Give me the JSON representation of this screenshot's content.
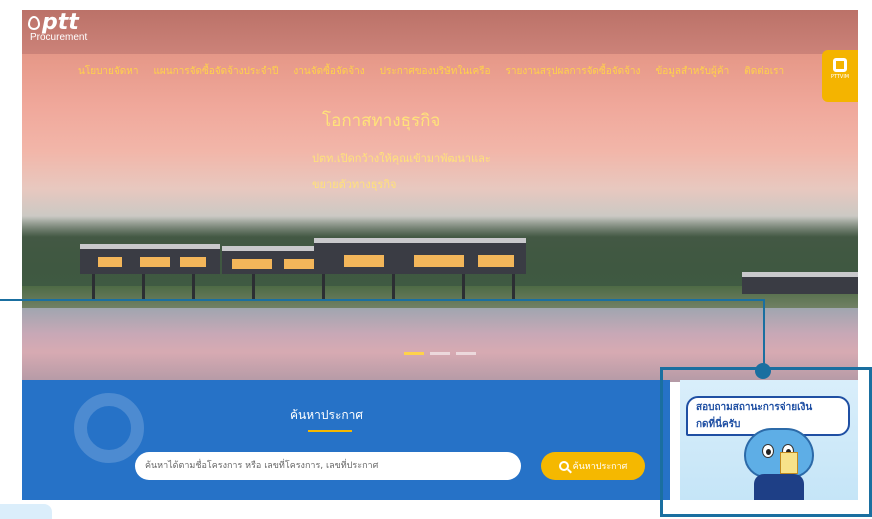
{
  "brand": {
    "logo_text": "ptt",
    "sub_text": "Procurement"
  },
  "nav": {
    "items": [
      "นโยบายจัดหา",
      "แผนการจัดซื้อจัดจ้างประจำปี",
      "งานจัดซื้อจัดจ้าง",
      "ประกาศของบริษัทในเครือ",
      "รายงานสรุปผลการจัดซื้อจัดจ้าง",
      "ข้อมูลสำหรับผู้ค้า",
      "ติดต่อเรา"
    ],
    "pttvim_label": "PTTVIM"
  },
  "hero": {
    "title": "โอกาสทางธุรกิจ",
    "subtitle_line1": "ปตท.เปิดกว้างให้คุณเข้ามาพัฒนาและ",
    "subtitle_line2": "ขยายตัวทางธุรกิจ",
    "active_slide": 1,
    "slide_count": 3
  },
  "search": {
    "title": "ค้นหาประกาศ",
    "placeholder": "ค้นหาได้ตามชื่อโครงการ หรือ เลขที่โครงการ, เลขที่ประกาศ",
    "button_label": "ค้นหาประกาศ"
  },
  "promo": {
    "line1": "สอบถามสถานะการจ่ายเงิน",
    "line2": "กดที่นี่ครับ"
  },
  "colors": {
    "nav_text": "#ffd24a",
    "search_panel": "#2672c7",
    "accent_button": "#f5b800",
    "highlight_frame": "#1a6fa0"
  }
}
